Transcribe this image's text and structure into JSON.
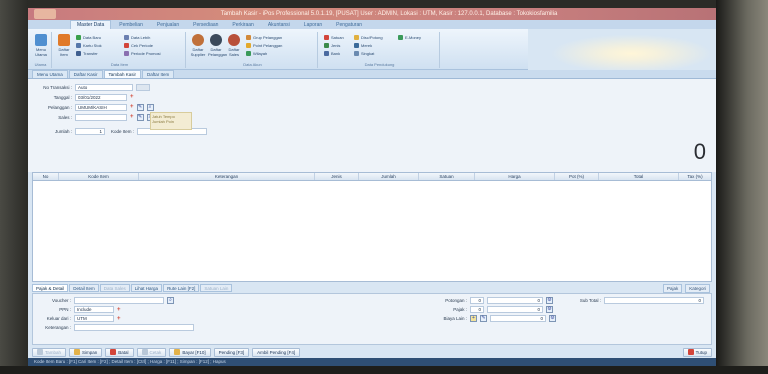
{
  "window": {
    "title": "Tambah Kasir - iPos Professional 5.0.1.19, [PUSAT] User : ADMIN, Lokasi : UTM, Kasir : 127.0.0.1, Database : Tokokiosfamilia"
  },
  "ribbon": {
    "tabs": [
      "Master Data",
      "Pembelian",
      "Penjualan",
      "Persediaan",
      "Perkiraan",
      "Akuntansi",
      "Laporan",
      "Pengaturan"
    ],
    "active_tab": "Master Data",
    "groups": [
      {
        "label": "Utama",
        "buttons": [
          "Menu Utama"
        ]
      },
      {
        "label": "Data Item",
        "buttons": [
          "Daftar Item",
          "Data Baru",
          "Kartu Stok",
          "Transfer",
          "Data Lebih",
          "Cek Periode",
          "Periode Promosi"
        ]
      },
      {
        "label": "Data Akun",
        "buttons": [
          "Daftar Supplier",
          "Daftar Pelanggan",
          "Daftar Sales",
          "Grup Pelanggan",
          "Point Pelanggan",
          "Wilayah"
        ]
      },
      {
        "label": "Data Pendukung",
        "buttons": [
          "Satuan",
          "Jenis",
          "Merek",
          "Bank",
          "Singkat",
          "Disc/Potong",
          "E-Money"
        ]
      }
    ]
  },
  "doc_tabs": [
    "Menu Utama",
    "Daftar Kasir",
    "Tambah Kasir",
    "Daftar Item"
  ],
  "doc_tab_active": "Tambah Kasir",
  "form": {
    "no_transaksi_label": "No Transaksi :",
    "no_transaksi_value": "Auto",
    "tanggal_label": "Tanggal :",
    "tanggal_value": "03/01/2022",
    "pelanggan_label": "Pelanggan :",
    "pelanggan_value": "UMUM/KASIH",
    "sales_label": "Sales :",
    "sales_value": "",
    "jumlah_label": "Jumlah :",
    "jumlah_value": "1",
    "kode_item_label": "Kode Item :",
    "info_box_line1": "Jatuh Tempo",
    "info_box_line2": "Jumlah Poin",
    "total": "0"
  },
  "grid": {
    "columns": [
      "No",
      "Kode Item",
      "Keterangan",
      "Jenis",
      "Jumlah",
      "Satuan",
      "Harga",
      "Pot (%)",
      "Total",
      "Tax (%)"
    ]
  },
  "bottom_tabs": [
    "Pajak & Detail",
    "Detail Item",
    "Data Sales",
    "Lihat Harga",
    "Rute Lain [F2]",
    "Satuan Lain"
  ],
  "bottom_tab_active": "Pajak & Detail",
  "right_links": [
    "Pajak",
    "Kategori"
  ],
  "bottom": {
    "voucher_label": "Voucher :",
    "ppn_label": "PPN :",
    "ppn_value": "Include",
    "keluar_dari_label": "Keluar dari :",
    "keluar_dari_value": "UTM",
    "keterangan_label": "Keterangan :",
    "potongan_label": "Potongan :",
    "potongan_value": "0",
    "potongan_value2": "0",
    "pajak_label": "Pajak :",
    "pajak_value": "0",
    "pajak_value2": "0",
    "biaya_lain_label": "Biaya Lain :",
    "biaya_lain_value2": "0",
    "sub_total_label": "Sub Total :",
    "sub_total_value": "0"
  },
  "toolbar": {
    "tambah": "Tambah",
    "simpan": "Simpan",
    "batal": "Batal",
    "cetak": "Cetak",
    "bayar": "Bayar [F10]",
    "pending": "Pending [F3]",
    "ambil_pending": "Ambil Pending [F4]",
    "tutup": "Tutup"
  },
  "status": "Kode Item Baru : [F1] Cari Item : [F2] ; Detail Item : [Ctrl] ; Harga : [F11] ; Simpan : [F12] ; Hapus"
}
